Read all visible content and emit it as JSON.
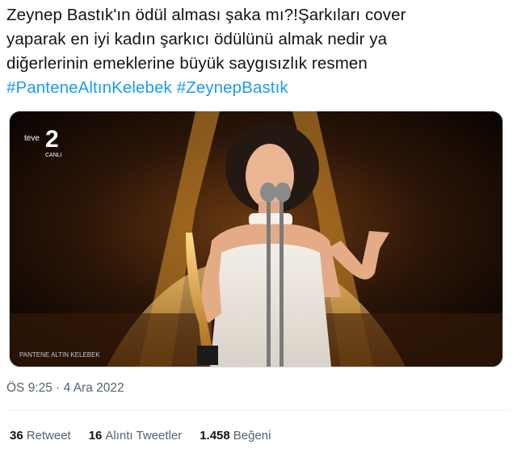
{
  "tweet": {
    "lines": [
      "Zeynep Bastık'ın ödül alması şaka mı?!Şarkıları cover",
      "yaparak en iyi kadın şarkıcı ödülünü almak nedir ya",
      "diğerlerinin emeklerine büyük saygısızlık resmen"
    ],
    "hashtags": [
      "#PanteneAltınKelebek",
      "#ZeynepBastık"
    ]
  },
  "media": {
    "channel_logo": "teve2",
    "channel_status": "CANLI",
    "stage_text": "PANTENE ALTIN KELEBEK"
  },
  "meta": {
    "timestamp": "ÖS 9:25 · 4 Ara 2022"
  },
  "stats": {
    "retweets": {
      "count": "36",
      "label": "Retweet"
    },
    "quotes": {
      "count": "16",
      "label": "Alıntı Tweetler"
    },
    "likes": {
      "count": "1.458",
      "label": "Beğeni"
    }
  },
  "colors": {
    "link": "#1d9bf0",
    "text": "#0f1419",
    "muted": "#536471"
  }
}
